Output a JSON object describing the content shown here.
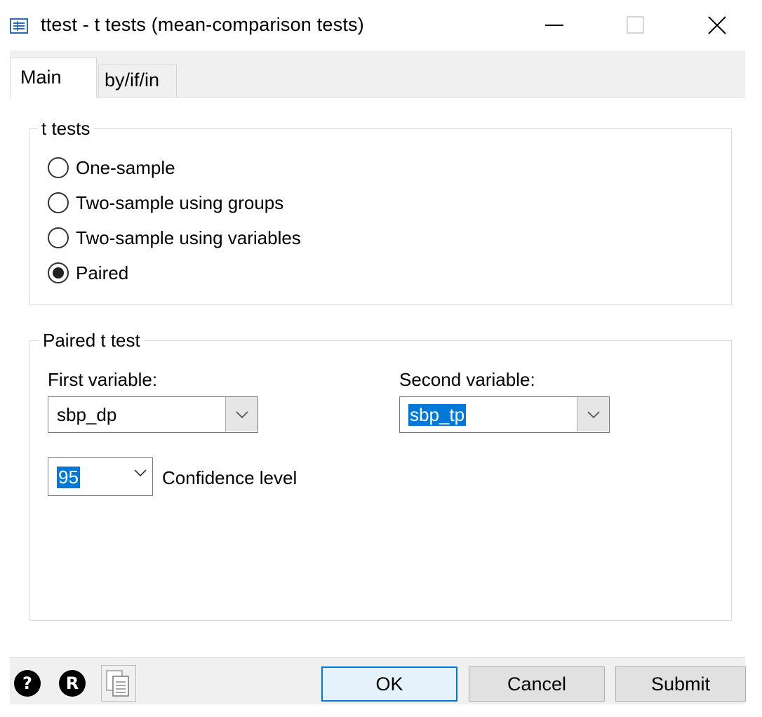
{
  "window": {
    "title": "ttest - t tests (mean-comparison tests)",
    "icons": {
      "app": "dialog-icon",
      "minimize": "minimize-icon",
      "maximize": "maximize-icon",
      "close": "close-icon"
    }
  },
  "tabs": [
    {
      "label": "Main",
      "active": true
    },
    {
      "label": "by/if/in",
      "active": false
    }
  ],
  "t_tests_group": {
    "legend": "t tests",
    "options": [
      {
        "label": "One-sample",
        "checked": false
      },
      {
        "label": "Two-sample using groups",
        "checked": false
      },
      {
        "label": "Two-sample using variables",
        "checked": false
      },
      {
        "label": "Paired",
        "checked": true
      }
    ]
  },
  "paired_group": {
    "legend": "Paired t test",
    "first_variable": {
      "label": "First variable:",
      "value": "sbp_dp"
    },
    "second_variable": {
      "label": "Second variable:",
      "value": "sbp_tp"
    },
    "confidence": {
      "value": "95",
      "label": "Confidence level"
    }
  },
  "footer": {
    "help_icon": "help-icon",
    "r_icon": "r-icon",
    "copy_icon": "copy-icon",
    "help_glyph": "?",
    "r_glyph": "R",
    "ok_label": "OK",
    "cancel_label": "Cancel",
    "submit_label": "Submit"
  },
  "colors": {
    "selection": "#0078d7",
    "default_button_border": "#0078d7"
  }
}
